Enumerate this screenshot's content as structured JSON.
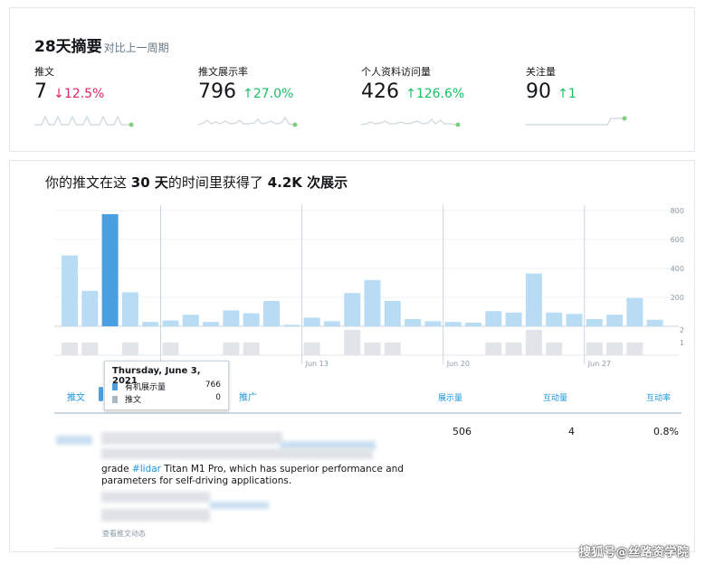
{
  "summary": {
    "title": "28天摘要",
    "subtitle": "对比上一周期",
    "metrics": [
      {
        "label": "推文",
        "value": "7",
        "change": "12.5%",
        "direction": "down",
        "arrow": "↓"
      },
      {
        "label": "推文展示率",
        "value": "796",
        "change": "27.0%",
        "direction": "up",
        "arrow": "↑"
      },
      {
        "label": "个人资料访问量",
        "value": "426",
        "change": "126.6%",
        "direction": "up",
        "arrow": "↑"
      },
      {
        "label": "关注量",
        "value": "90",
        "change": "1",
        "direction": "up",
        "arrow": "↑"
      }
    ]
  },
  "impressions": {
    "title_pre": "你的推文在这",
    "title_days": "30 天",
    "title_mid": "的时间里获得了",
    "title_total": "4.2K 次展示"
  },
  "chart_data": {
    "type": "bar",
    "yticks": [
      800,
      600,
      400,
      200
    ],
    "y2ticks": [
      2,
      1
    ],
    "ylim": [
      0,
      800
    ],
    "y2lim": [
      0,
      2
    ],
    "xticks": [
      "Jun 13",
      "Jun 20",
      "Jun 27"
    ],
    "highlight_index": 2,
    "series": [
      {
        "name": "有机展示量",
        "color": "#b9dcf5",
        "highlight_color": "#4a9fe0",
        "values": [
          490,
          245,
          775,
          235,
          30,
          40,
          80,
          30,
          110,
          90,
          175,
          10,
          60,
          35,
          230,
          320,
          175,
          50,
          35,
          30,
          25,
          105,
          95,
          365,
          95,
          85,
          50,
          80,
          195,
          45
        ]
      },
      {
        "name": "推文",
        "color": "#e1e5e9",
        "values": [
          1,
          1,
          0,
          1,
          0,
          1,
          0,
          0,
          1,
          1,
          0,
          0,
          1,
          0,
          2,
          1,
          1,
          0,
          0,
          0,
          0,
          1,
          1,
          2,
          1,
          0,
          1,
          1,
          1,
          0
        ]
      }
    ]
  },
  "tooltip": {
    "date": "Thursday, June 3, 2021",
    "rows": [
      {
        "label": "有机展示量",
        "value": "766",
        "color": "#4a9fe0"
      },
      {
        "label": "推文",
        "value": "0",
        "color": "#aab8c2"
      }
    ]
  },
  "table": {
    "tab_tweets": "推文",
    "tab_promoted": "推广",
    "headers": [
      "展示量",
      "互动量",
      "互动率"
    ],
    "row": {
      "impressions": "506",
      "engagements": "4",
      "rate": "0.8%",
      "text_pre": "grade ",
      "hashtag": "#lidar",
      "text_post": " Titan M1 Pro, which has superior performance and parameters for self-driving applications.",
      "view_activity": "查看推文动态"
    }
  },
  "watermark": "搜狐号@丝路资学院"
}
